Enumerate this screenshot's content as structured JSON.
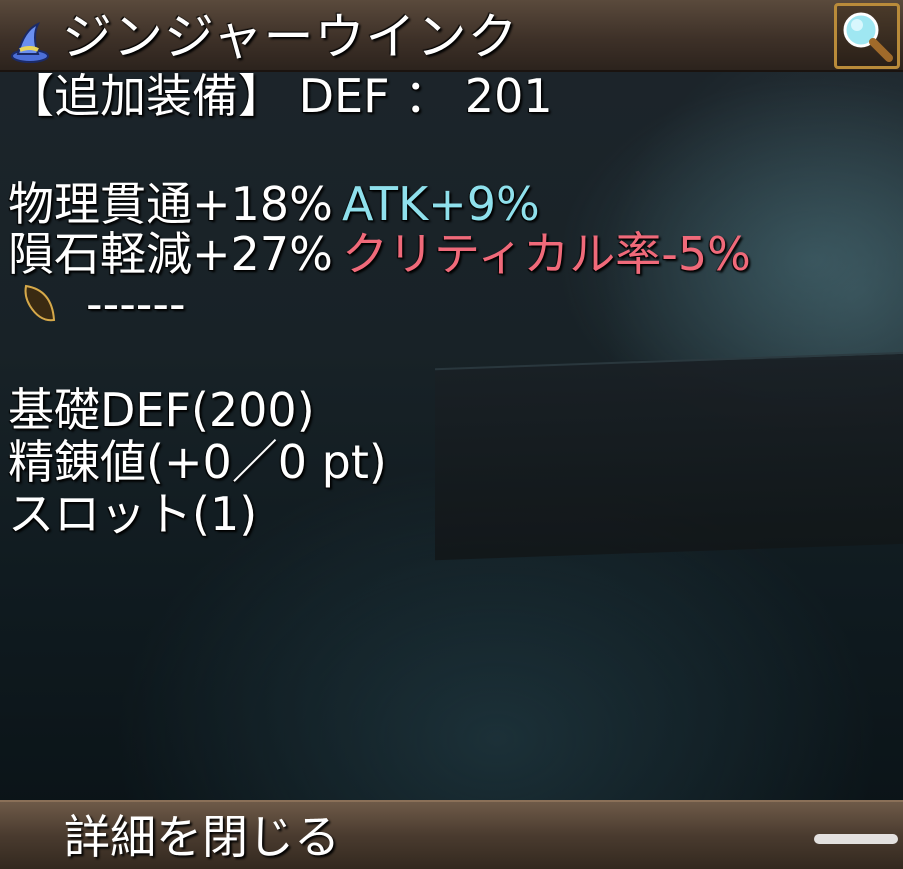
{
  "header": {
    "title": "ジンジャーウインク",
    "item_icon": "wizard-hat-icon",
    "search_icon": "magnifier-icon"
  },
  "details": {
    "equip_line": "【追加装備】 DEF ： 201",
    "stat_row1_left": "物理貫通+18%",
    "stat_row1_right": "ATK+9%",
    "stat_row2_left": "隕石軽減+27%",
    "stat_row2_right": "クリティカル率-5%",
    "stat_row3_right": "------",
    "base_def": "基礎DEF(200)",
    "refine": "精錬値(+0／0 pt)",
    "slot": "スロット(1)"
  },
  "footer": {
    "close_label": "詳細を閉じる"
  },
  "colors": {
    "positive_stat": "#8fe0ec",
    "negative_stat": "#f06a7a",
    "panel_brown": "#4a3b2f",
    "search_border": "#b98b3a"
  }
}
